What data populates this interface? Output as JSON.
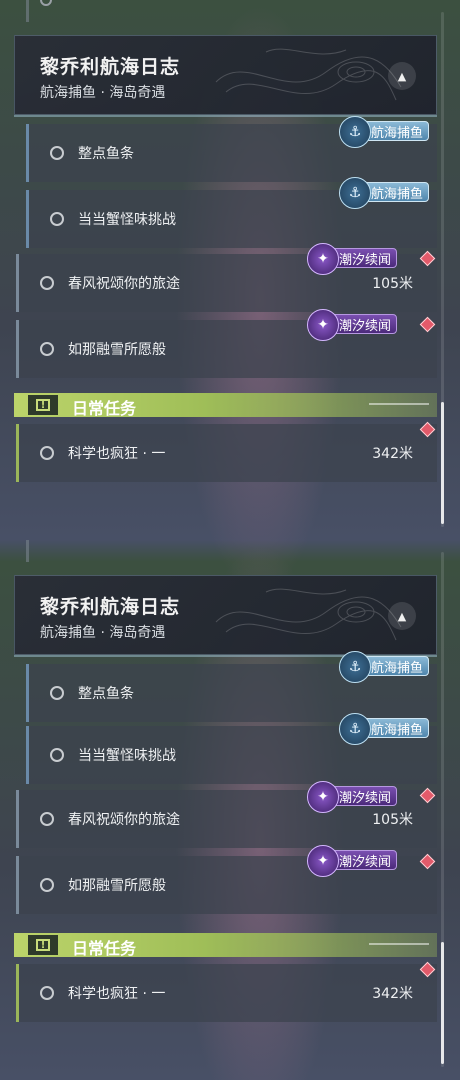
{
  "screens": [
    {
      "header": {
        "title": "黎乔利航海日志",
        "subtitle": "航海捕鱼 · 海岛奇遇"
      },
      "quests": [
        {
          "label": "整点鱼条",
          "tag": "航海捕鱼",
          "distance": ""
        },
        {
          "label": "当当蟹怪味挑战",
          "tag": "航海捕鱼",
          "distance": ""
        },
        {
          "label": "春风祝颂你的旅途",
          "tag": "潮汐续闻",
          "distance": "105米"
        },
        {
          "label": "如那融雪所愿般",
          "tag": "潮汐续闻",
          "distance": ""
        }
      ],
      "daily": {
        "title": "日常任务",
        "quest": {
          "label": "科学也疯狂 · 一",
          "distance": "342米"
        }
      }
    },
    {
      "header": {
        "title": "黎乔利航海日志",
        "subtitle": "航海捕鱼 · 海岛奇遇"
      },
      "quests": [
        {
          "label": "整点鱼条",
          "tag": "航海捕鱼",
          "distance": ""
        },
        {
          "label": "当当蟹怪味挑战",
          "tag": "航海捕鱼",
          "distance": ""
        },
        {
          "label": "春风祝颂你的旅途",
          "tag": "潮汐续闻",
          "distance": "105米"
        },
        {
          "label": "如那融雪所愿般",
          "tag": "潮汐续闻",
          "distance": ""
        }
      ],
      "daily": {
        "title": "日常任务",
        "quest": {
          "label": "科学也疯狂 · 一",
          "distance": "342米"
        }
      }
    }
  ],
  "icons": {
    "collapse": "chevron-up-icon",
    "fishing_tag": "anchor-icon",
    "tide_tag": "star-icon",
    "daily": "exclamation-icon",
    "tracking": "diamond-icon"
  },
  "colors": {
    "fishing_tag": "#5b93b8",
    "tide_tag": "#5a3490",
    "daily_bar": "#b6cf65",
    "tracking_marker": "#e25a6a"
  }
}
